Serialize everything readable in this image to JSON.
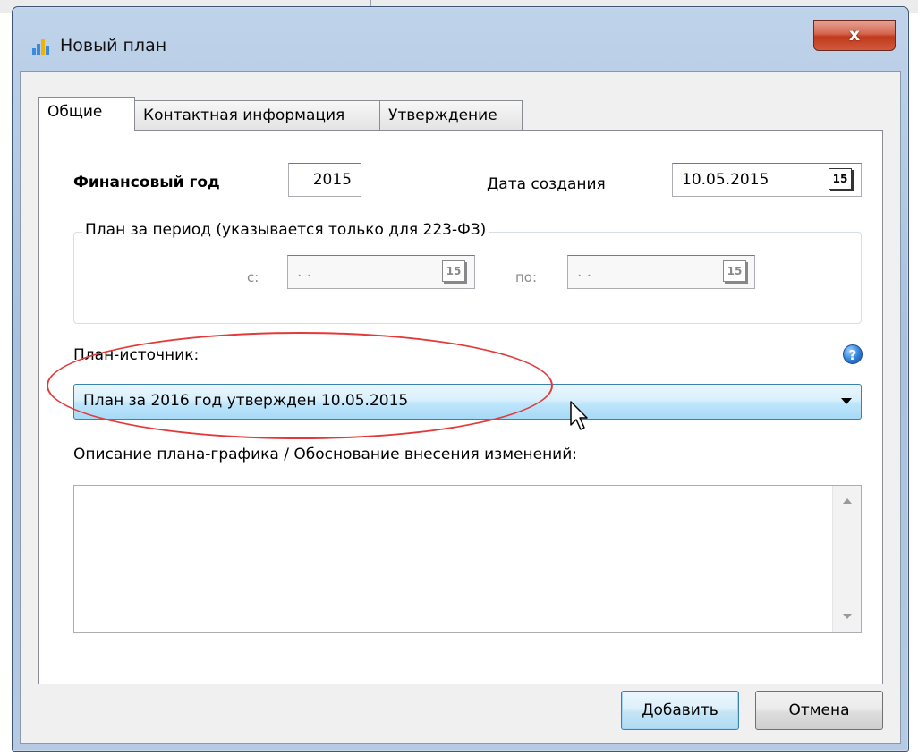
{
  "window": {
    "title": "Новый план",
    "close_label": "x"
  },
  "tabs": [
    {
      "label": "Общие",
      "active": true
    },
    {
      "label": "Контактная информация",
      "active": false
    },
    {
      "label": "Утверждение",
      "active": false
    }
  ],
  "general": {
    "fiscal_year_label": "Финансовый год",
    "fiscal_year_value": "2015",
    "creation_date_label": "Дата создания",
    "creation_date_value": "10.05.2015",
    "calendar_icon_label": "15"
  },
  "period": {
    "legend": "План за период (указывается только для 223-ФЗ)",
    "from_label": "с:",
    "from_value": ". .",
    "to_label": "по:",
    "to_value": ". .",
    "calendar_icon_label": "15"
  },
  "source_plan": {
    "label": "План-источник:",
    "selected": "План за 2016 год утвержден 10.05.2015",
    "help_icon": "?"
  },
  "description": {
    "label": "Описание плана-графика / Обоснование внесения изменений:",
    "value": ""
  },
  "buttons": {
    "add": "Добавить",
    "cancel": "Отмена"
  },
  "colors": {
    "annotation": "#e23a3a",
    "accent_blue": "#3c7fb1",
    "close_red": "#c0391c"
  }
}
